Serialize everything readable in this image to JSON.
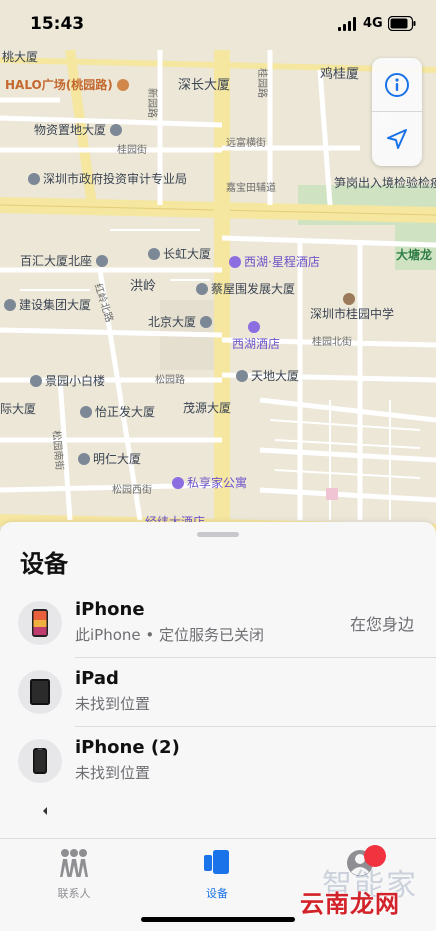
{
  "status": {
    "time": "15:43",
    "network": "4G"
  },
  "map": {
    "labels": {
      "l1": "桃大厦",
      "l2": "HALO广场(桃园路)",
      "l3": "深长大厦",
      "l4": "鸡桂厦",
      "l5": "物资置地大厦",
      "l6": "远富横街",
      "l7": "桂园街",
      "l8": "深圳市政府投资审计专业局",
      "l9": "嘉宝田辅道",
      "l10": "笋岗出入境检验检疫",
      "l11": "百汇大厦北座",
      "l12": "长虹大厦",
      "l13": "西湖·星程酒店",
      "l14": "大塘龙",
      "l15": "洪岭",
      "l16": "蔡屋围发展大厦",
      "l17": "建设集团大厦",
      "l18": "深圳市桂园中学",
      "l19": "北京大厦",
      "l20": "西湖酒店",
      "l21": "桂园北街",
      "l22": "景园小白楼",
      "l23": "松园路",
      "l24": "天地大厦",
      "l25": "际大厦",
      "l26": "怡正发大厦",
      "l27": "茂源大厦",
      "l28": "明仁大厦",
      "l29": "私享家公寓",
      "l30": "松园西街",
      "l31": "经纬大酒店",
      "r1": "红岭北路",
      "r2": "松园南街",
      "r3": "新园路",
      "r4": "桂园路"
    }
  },
  "controls": {
    "info_icon": "info-icon",
    "location_icon": "location-arrow-icon"
  },
  "sheet": {
    "title": "设备",
    "devices": [
      {
        "name": "iPhone",
        "subtitle": "此iPhone • 定位服务已关闭",
        "distance": "在您身边",
        "icon": "iphone-color-icon"
      },
      {
        "name": "iPad",
        "subtitle": "未找到位置",
        "icon": "ipad-icon"
      },
      {
        "name": "iPhone (2)",
        "subtitle": "未找到位置",
        "icon": "iphone-icon"
      }
    ]
  },
  "tabs": [
    {
      "label": "联系人",
      "icon": "people-icon",
      "active": false
    },
    {
      "label": "设备",
      "icon": "devices-icon",
      "active": true
    },
    {
      "label": "",
      "icon": "me-icon",
      "active": false
    }
  ],
  "watermark": {
    "faint": "智能家",
    "main": "云南龙网"
  },
  "colors": {
    "accent": "#1a73e8",
    "badge": "#f1323f",
    "map_bg": "#ece7d7",
    "road": "#f8e9a6"
  }
}
